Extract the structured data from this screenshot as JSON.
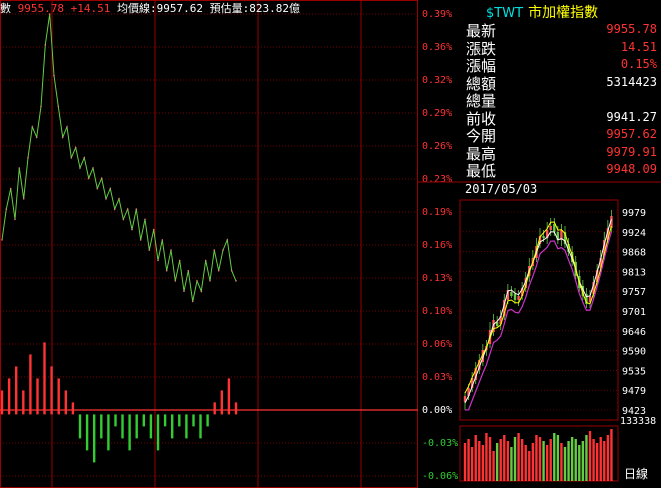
{
  "header": {
    "ticker_prefix": "數",
    "price": "9955.78",
    "change": "+14.51",
    "avg_label": "均價線:9957.62",
    "est_label": "預估量:823.82億"
  },
  "colors": {
    "up": "#ff3333",
    "down": "#33cc33",
    "grid": "#990000",
    "text": "#ffffff",
    "yellow": "#ffff00",
    "cyan": "#00e0e0"
  },
  "intraday": {
    "pct_ticks": [
      "0.39%",
      "0.36%",
      "0.32%",
      "0.29%",
      "0.26%",
      "0.23%",
      "0.19%",
      "0.16%",
      "0.13%",
      "0.10%",
      "0.06%",
      "0.03%",
      "0.00%",
      "-0.03%",
      "-0.06%"
    ]
  },
  "quote": {
    "symbol": "$TWT",
    "name": "市加權指數",
    "rows": [
      {
        "label": "最新",
        "value": "9955.78",
        "color": "#ff3333"
      },
      {
        "label": "漲跌",
        "value": "14.51",
        "color": "#ff3333"
      },
      {
        "label": "漲幅",
        "value": "0.15%",
        "color": "#ff3333"
      },
      {
        "label": "總額",
        "value": "5314423",
        "color": "#ffffff"
      },
      {
        "label": "總量",
        "value": "",
        "color": "#ffffff"
      },
      {
        "label": "前收",
        "value": "9941.27",
        "color": "#ffffff"
      },
      {
        "label": "今開",
        "value": "9957.62",
        "color": "#ff3333"
      },
      {
        "label": "最高",
        "value": "9979.91",
        "color": "#ff3333"
      },
      {
        "label": "最低",
        "value": "9948.09",
        "color": "#ff3333"
      }
    ]
  },
  "daily": {
    "date": "2017/05/03",
    "price_ticks": [
      "9979",
      "9924",
      "9868",
      "9813",
      "9757",
      "9701",
      "9646",
      "9590",
      "9535",
      "9479",
      "9423"
    ],
    "volume_tick": "133338",
    "period_label": "日線"
  },
  "chart_data": [
    {
      "type": "line",
      "title": "",
      "ylabel": "",
      "ylim": [
        -0.06,
        0.39
      ],
      "series": [
        {
          "name": "",
          "values": [
            0.17,
            0.2,
            0.22,
            0.19,
            0.24,
            0.21,
            0.25,
            0.28,
            0.27,
            0.3,
            0.36,
            0.39,
            0.33,
            0.3,
            0.27,
            0.28,
            0.25,
            0.26,
            0.24,
            0.25,
            0.23,
            0.24,
            0.22,
            0.23,
            0.21,
            0.22,
            0.2,
            0.21,
            0.19,
            0.2,
            0.18,
            0.2,
            0.17,
            0.19,
            0.16,
            0.18,
            0.15,
            0.17,
            0.14,
            0.16,
            0.13,
            0.15,
            0.12,
            0.14,
            0.11,
            0.13,
            0.12,
            0.15,
            0.13,
            0.16,
            0.14,
            0.16,
            0.17,
            0.14,
            0.13
          ]
        }
      ]
    },
    {
      "type": "bar",
      "title": "",
      "ylim": [
        -0.06,
        0.06
      ],
      "series": [
        {
          "name": "",
          "values": [
            0.02,
            0.03,
            0.04,
            0.02,
            0.05,
            0.03,
            0.06,
            0.04,
            0.03,
            0.02,
            0.01,
            -0.02,
            -0.03,
            -0.04,
            -0.02,
            -0.03,
            -0.01,
            -0.02,
            -0.03,
            -0.02,
            -0.01,
            -0.02,
            -0.03,
            -0.01,
            -0.02,
            -0.01,
            -0.02,
            -0.01,
            -0.02,
            -0.01,
            0.01,
            0.02,
            0.03,
            0.01
          ]
        }
      ]
    }
  ]
}
